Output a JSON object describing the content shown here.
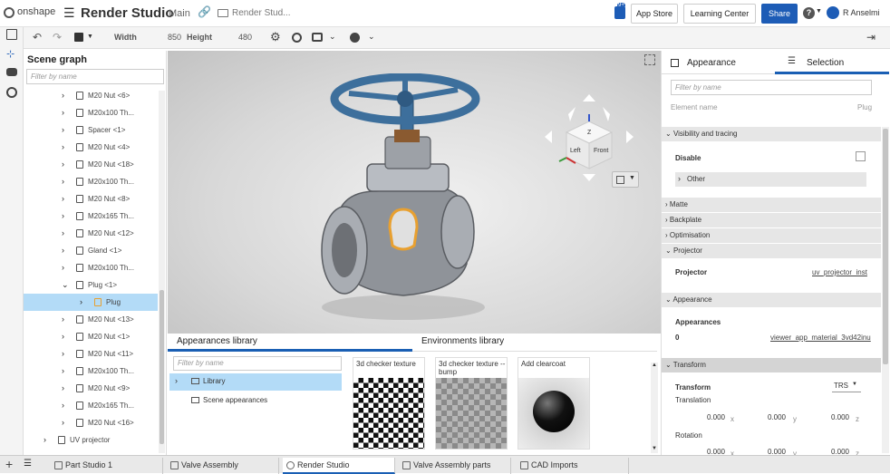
{
  "header": {
    "logo_text": "onshape",
    "title": "Render Studio",
    "branch": "Main",
    "breadcrumb": "Render Stud...",
    "app_store": "App Store",
    "learning_center": "Learning Center",
    "share": "Share",
    "help": "?",
    "user": "R Anselmi",
    "notif_count": "9+"
  },
  "toolbar": {
    "width_label": "Width",
    "width_value": "850",
    "height_label": "Height",
    "height_value": "480"
  },
  "scene_graph": {
    "title": "Scene graph",
    "filter_placeholder": "Filter by name",
    "items": [
      {
        "label": "M20 Nut <6>",
        "level": 1,
        "expanded": false
      },
      {
        "label": "M20x100 Th...",
        "level": 1,
        "expanded": false
      },
      {
        "label": "Spacer <1>",
        "level": 1,
        "expanded": false
      },
      {
        "label": "M20 Nut <4>",
        "level": 1,
        "expanded": false
      },
      {
        "label": "M20 Nut <18>",
        "level": 1,
        "expanded": false
      },
      {
        "label": "M20x100 Th...",
        "level": 1,
        "expanded": false
      },
      {
        "label": "M20 Nut <8>",
        "level": 1,
        "expanded": false
      },
      {
        "label": "M20x165 Th...",
        "level": 1,
        "expanded": false
      },
      {
        "label": "M20 Nut <12>",
        "level": 1,
        "expanded": false
      },
      {
        "label": "Gland <1>",
        "level": 1,
        "expanded": false
      },
      {
        "label": "M20x100 Th...",
        "level": 1,
        "expanded": false
      },
      {
        "label": "Plug <1>",
        "level": 1,
        "expanded": true
      },
      {
        "label": "Plug",
        "level": 2,
        "expanded": false,
        "selected": true
      },
      {
        "label": "M20 Nut <13>",
        "level": 1,
        "expanded": false
      },
      {
        "label": "M20 Nut <1>",
        "level": 1,
        "expanded": false
      },
      {
        "label": "M20 Nut <11>",
        "level": 1,
        "expanded": false
      },
      {
        "label": "M20x100 Th...",
        "level": 1,
        "expanded": false
      },
      {
        "label": "M20 Nut <9>",
        "level": 1,
        "expanded": false
      },
      {
        "label": "M20x165 Th...",
        "level": 1,
        "expanded": false
      },
      {
        "label": "M20 Nut <16>",
        "level": 1,
        "expanded": false
      },
      {
        "label": "UV projector",
        "level": 0,
        "expanded": false
      }
    ]
  },
  "viewcube": {
    "top": "Z",
    "left": "Left",
    "front": "Front",
    "x_axis": "X",
    "y_axis": "Y"
  },
  "libraries": {
    "appearances_tab": "Appearances library",
    "environments_tab": "Environments library",
    "filter_placeholder": "Filter by name",
    "folders": [
      "Library",
      "Scene appearances"
    ],
    "tiles": [
      {
        "label": "3d checker texture"
      },
      {
        "label": "3d checker texture -- bump"
      },
      {
        "label": "Add clearcoat"
      }
    ]
  },
  "right_panel": {
    "tab_appearance": "Appearance",
    "tab_selection": "Selection",
    "filter_placeholder": "Filter by name",
    "element_name_label": "Element name",
    "element_name_value": "Plug",
    "visibility_section": "Visibility and tracing",
    "disable_label": "Disable",
    "other_label": "Other",
    "collapsed_sections": [
      "Matte",
      "Backplate",
      "Optimisation"
    ],
    "projector_section": "Projector",
    "projector_label": "Projector",
    "projector_value": "uv_projector_inst",
    "appearance_section": "Appearance",
    "appearances_label": "Appearances",
    "appearances_index": "0",
    "appearances_value": "viewer_app_material_3vd42inu",
    "transform_section": "Transform",
    "transform_label": "Transform",
    "transform_mode": "TRS",
    "translation_label": "Translation",
    "rotation_label": "Rotation",
    "translation": {
      "x": "0.000",
      "y": "0.000",
      "z": "0.000"
    },
    "rotation": {
      "x": "0.000",
      "y": "0.000",
      "z": "0.000"
    },
    "axis_x": "x",
    "axis_y": "y",
    "axis_z": "z"
  },
  "tabs": [
    {
      "label": "Part Studio 1"
    },
    {
      "label": "Valve Assembly"
    },
    {
      "label": "Render Studio",
      "active": true
    },
    {
      "label": "Valve Assembly parts"
    },
    {
      "label": "CAD Imports"
    }
  ],
  "colors": {
    "accent": "#1a5fb4",
    "share": "#1d5cb6",
    "selected": "#b3dbf7",
    "valve_blue": "#3d6f9c",
    "highlight": "#e8a030"
  }
}
